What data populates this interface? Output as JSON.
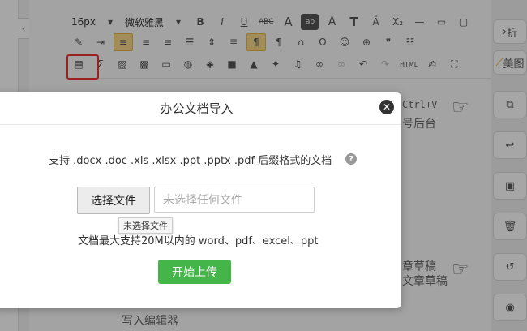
{
  "toolbar": {
    "font_size": "16px",
    "font_family": "微软雅黑",
    "row1_icons": [
      "chevron-down-icon",
      "bold-icon",
      "italic-icon",
      "underline-icon",
      "strikethrough-icon",
      "font-color-icon",
      "highlight-icon",
      "font-size-icon",
      "letter-spacing-icon",
      "subscript-icon",
      "line-icon",
      "page-icon",
      "square-icon"
    ],
    "row2_icons": [
      "eraser-icon",
      "indent-icon",
      "align-left-icon",
      "align-center-icon",
      "align-right-icon",
      "justify-icon",
      "line-height-icon",
      "paragraph-spacing-icon",
      "ltr-icon",
      "rtl-icon",
      "format-painter-icon",
      "omega-icon",
      "emoji-icon",
      "search-icon",
      "quote-icon",
      "list-icon"
    ],
    "row3_icons": [
      "office-import-icon",
      "sigma-icon",
      "image-icon",
      "gallery-icon",
      "border-icon",
      "palette-icon",
      "shield-icon",
      "video-icon",
      "fill-icon",
      "magic-icon",
      "music-icon",
      "link-icon",
      "unlink-icon",
      "undo-icon",
      "redo-icon",
      "html-icon",
      "edit-icon",
      "fullscreen-icon"
    ],
    "symbols": {
      "abc": "ABC",
      "font_a": "A",
      "omega": "Ω",
      "quote": "❞",
      "html": "HTML",
      "bold_t": "T"
    }
  },
  "right_sidebar": {
    "collapse_label": "折",
    "beautify_label": "美图",
    "icons": [
      "copy-icon",
      "undo-arrow-icon",
      "save-icon",
      "trash-icon",
      "history-icon",
      "eye-icon"
    ]
  },
  "background": {
    "hint_key": "Ctrl+V",
    "hint_1": "号后台",
    "hint_2a": "章草稿",
    "hint_2b": "文章草稿",
    "hint_3": "写入编辑器"
  },
  "dialog": {
    "title": "办公文档导入",
    "close_symbol": "✕",
    "description": "支持 .docx .doc .xls .xlsx .ppt .pptx .pdf 后缀格式的文档",
    "help_symbol": "?",
    "choose_file_label": "选择文件",
    "file_input_placeholder": "未选择任何文件",
    "tooltip": "未选择文件",
    "limit_text": "文档最大支持20M以内的 word、pdf、excel、ppt",
    "upload_label": "开始上传"
  },
  "colors": {
    "accent_green": "#44b549",
    "highlight_red": "#e33333",
    "active_yellow": "#f6d98a"
  }
}
